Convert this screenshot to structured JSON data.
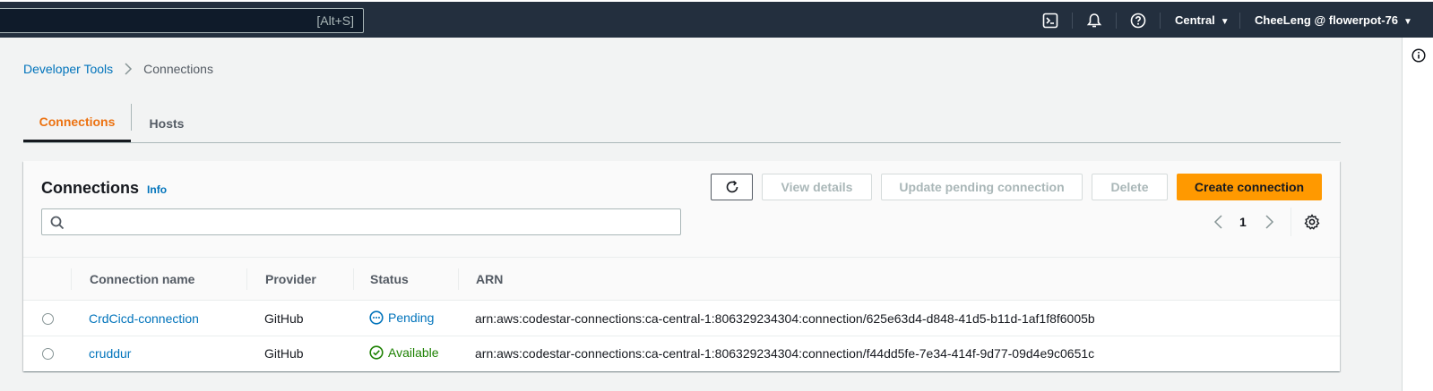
{
  "topnav": {
    "search_shortcut": "[Alt+S]",
    "region": "Central",
    "account": "CheeLeng @ flowerpot-76",
    "icons": [
      "cloudshell-icon",
      "bell-icon",
      "help-icon"
    ]
  },
  "breadcrumb": {
    "parent": "Developer Tools",
    "current": "Connections"
  },
  "tabs": [
    {
      "label": "Connections",
      "active": true
    },
    {
      "label": "Hosts",
      "active": false
    }
  ],
  "panel": {
    "title": "Connections",
    "info": "Info",
    "buttons": {
      "view_details": "View details",
      "update_pending": "Update pending connection",
      "delete": "Delete",
      "create": "Create connection"
    },
    "filter_value": "",
    "page": "1"
  },
  "table": {
    "columns": [
      "Connection name",
      "Provider",
      "Status",
      "ARN"
    ],
    "rows": [
      {
        "name": "CrdCicd-connection",
        "provider": "GitHub",
        "status": "Pending",
        "arn": "arn:aws:codestar-connections:ca-central-1:806329234304:connection/625e63d4-d848-41d5-b11d-1af1f8f6005b"
      },
      {
        "name": "cruddur",
        "provider": "GitHub",
        "status": "Available",
        "arn": "arn:aws:codestar-connections:ca-central-1:806329234304:connection/f44dd5fe-7e34-414f-9d77-09d4e9c0651c"
      }
    ]
  },
  "colors": {
    "nav_bg": "#232f3e",
    "link": "#0073bb",
    "accent_tab": "#ec7211",
    "primary_button": "#ff9900",
    "success": "#1d8102"
  }
}
